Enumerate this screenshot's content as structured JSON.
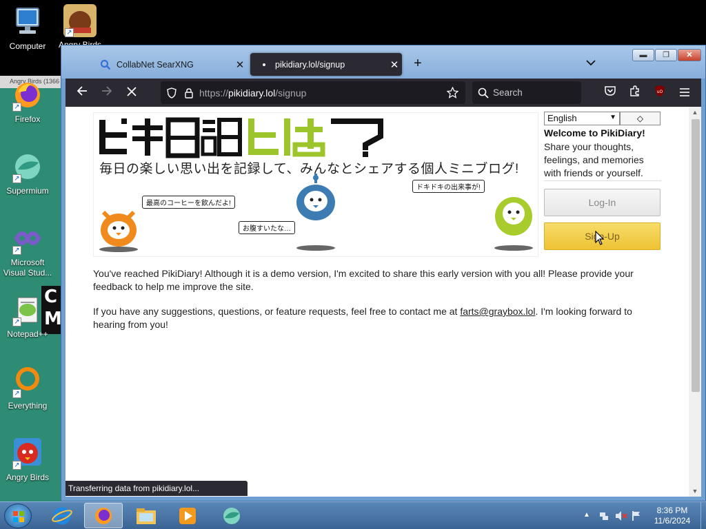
{
  "desktop": {
    "strip_text": "Angry Birds (1366",
    "partial_text": "C M",
    "icons": [
      {
        "label": "Computer",
        "icon": "computer-icon"
      },
      {
        "label": "Angry Birds",
        "icon": "angry-birds-icon"
      },
      {
        "label": "Firefox",
        "icon": "firefox-icon"
      },
      {
        "label": "Supermium",
        "icon": "supermium-icon"
      },
      {
        "label": "Microsoft Visual Stud...",
        "icon": "visual-studio-icon"
      },
      {
        "label": "Notepad++",
        "icon": "notepadpp-icon"
      },
      {
        "label": "Everything",
        "icon": "everything-icon"
      },
      {
        "label": "Angry Birds",
        "icon": "angry-birds-icon"
      }
    ]
  },
  "browser": {
    "tabs": [
      {
        "title": "CollabNet SearXNG",
        "icon": "search-icon",
        "active": false
      },
      {
        "title": "pikidiary.lol/signup",
        "icon": "loading-dot-icon",
        "active": true
      }
    ],
    "new_tab_label": "+",
    "url_prefix": "https://",
    "url_host": "pikidiary.lol",
    "url_path": "/signup",
    "search_placeholder": "Search",
    "status_text": "Transferring data from pikidiary.lol..."
  },
  "page": {
    "logo_text": "ピキ日記とは?",
    "tagline": "毎日の楽しい思い出を記録して、みんなとシェアする個人ミニブログ!",
    "bubbles": [
      "最高のコーヒーを飲んだよ!",
      "お腹すいたな…",
      "ドキドキの出来事が!"
    ],
    "language_selected": "English",
    "theme_toggle": "◇",
    "welcome_title": "Welcome to PikiDiary!",
    "welcome_desc": "Share your thoughts, feelings, and memories with friends or yourself.",
    "login_label": "Log-In",
    "signup_label": "Sign-Up",
    "para1": "You've reached PikiDiary! Although it is a demo version, I'm excited to share this early version with you all! Please provide your feedback to help me improve the site.",
    "para2_before": "If you have any suggestions, questions, or feature requests, feel free to contact me at ",
    "para2_email": "farts@graybox.lol",
    "para2_after": ". I'm looking forward to hearing from you!"
  },
  "taskbar": {
    "apps": [
      "internet-explorer-icon",
      "firefox-icon",
      "file-explorer-icon",
      "media-player-icon",
      "supermium-icon"
    ],
    "time": "8:36 PM",
    "date": "11/6/2024"
  },
  "colors": {
    "browser_dark": "#2b2a33",
    "desktop_teal": "#2e8c74",
    "logo_green": "#9cc42b",
    "signup_yellow": "#eec233",
    "mascot_orange": "#f18a1c",
    "mascot_blue": "#3d7cb3",
    "mascot_green": "#a8cc2c"
  }
}
